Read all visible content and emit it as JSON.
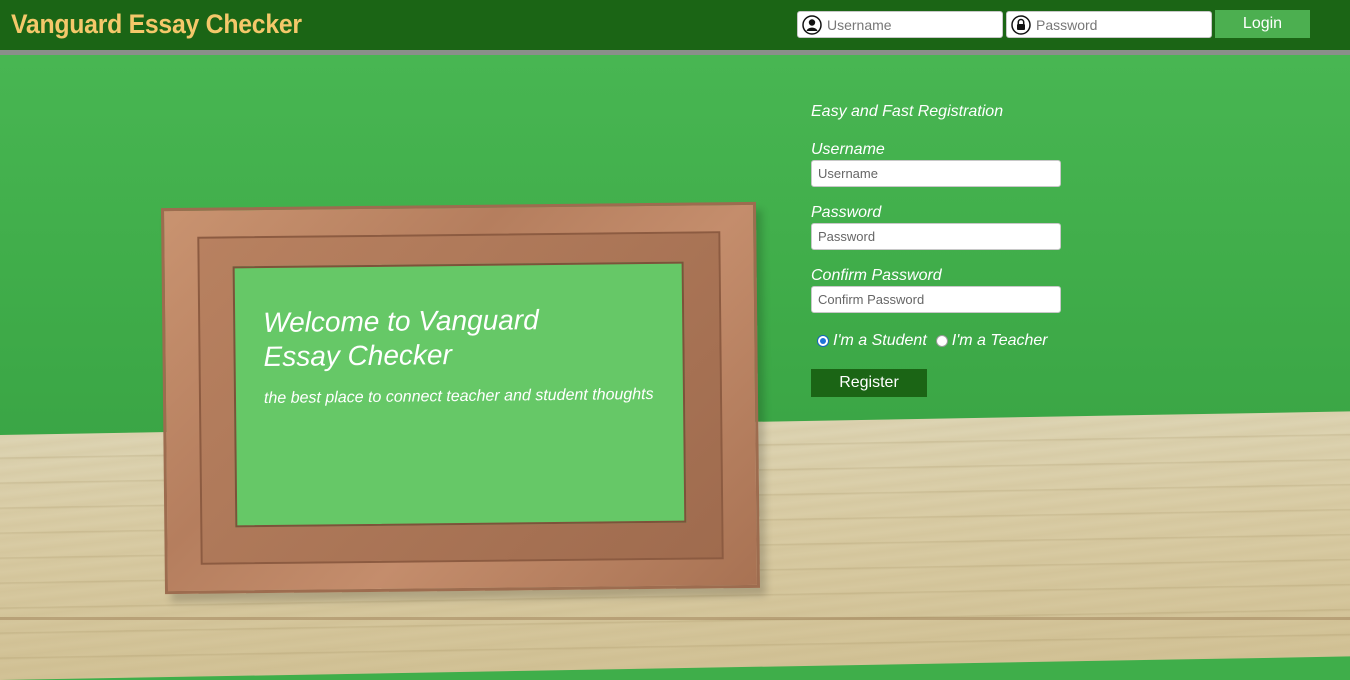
{
  "header": {
    "brand": "Vanguard Essay Checker",
    "username_placeholder": "Username",
    "password_placeholder": "Password",
    "login_label": "Login",
    "username_icon": "user-icon",
    "password_icon": "lock-icon"
  },
  "hero": {
    "title_line1": "Welcome to Vanguard",
    "title_line2": "Essay Checker",
    "subtitle": "the best place to connect teacher and student thoughts"
  },
  "registration": {
    "title": "Easy and Fast Registration",
    "username_label": "Username",
    "username_placeholder": "Username",
    "password_label": "Password",
    "password_placeholder": "Password",
    "confirm_label": "Confirm Password",
    "confirm_placeholder": "Confirm Password",
    "role_options": [
      {
        "label": "I'm a Student",
        "selected": true
      },
      {
        "label": "I'm a Teacher",
        "selected": false
      }
    ],
    "register_label": "Register"
  },
  "colors": {
    "header_bg": "#1b6515",
    "brand_text": "#f4c86a",
    "login_button": "#4caf50",
    "wall_green": "#40ad4a",
    "register_button": "#1b6515"
  }
}
